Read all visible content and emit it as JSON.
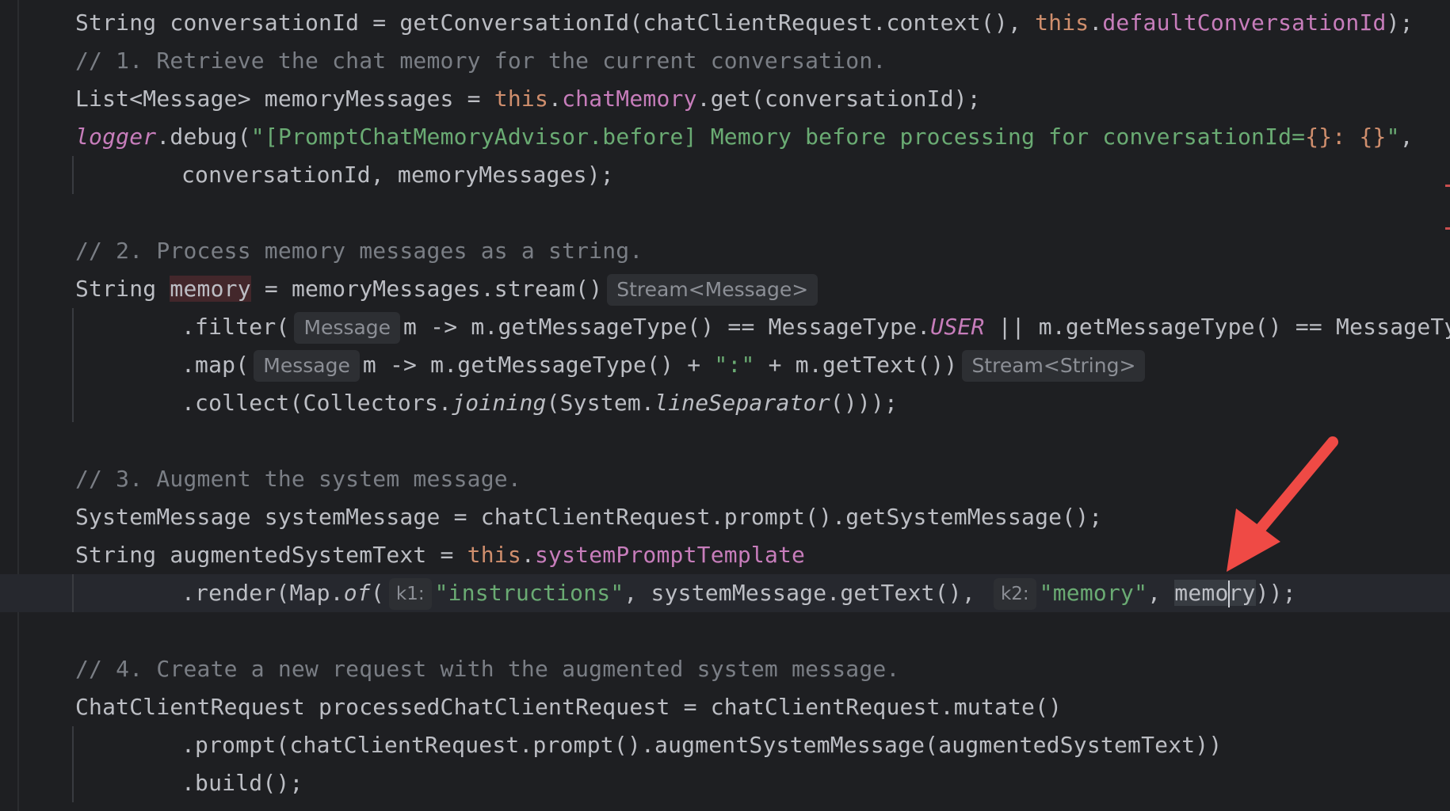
{
  "code": {
    "line1": {
      "a": "String conversationId = getConversationId(chatClientRequest.context(), ",
      "this": "this",
      "dot": ".",
      "field": "defaultConversationId",
      "end": ");"
    },
    "line2": "// 1. Retrieve the chat memory for the current conversation.",
    "line3": {
      "a": "List<Message> memoryMessages = ",
      "this": "this",
      "dot": ".",
      "field": "chatMemory",
      "end": ".get(conversationId);"
    },
    "line4": {
      "logger": "logger",
      "a": ".debug(",
      "str": "\"[PromptChatMemoryAdvisor.before] Memory before processing for conversationId=",
      "braces": "{}: {}",
      "str_end": "\"",
      "end": ","
    },
    "line5": "conversationId, memoryMessages);",
    "line6": "// 2. Process memory messages as a string.",
    "line7": {
      "a": "String ",
      "var": "memory",
      "b": " = memoryMessages.stream()",
      "hint": "Stream<Message>"
    },
    "line8": {
      "a": ".filter(",
      "hint": "Message",
      "b": "m -> m.getMessageType() == MessageType.",
      "enum": "USER",
      "c": " || m.getMessageType() == MessageTyp"
    },
    "line9": {
      "a": ".map(",
      "hint": "Message",
      "b": "m -> m.getMessageType() + ",
      "str": "\":\"",
      "c": " + m.getText())",
      "hint2": "Stream<String>"
    },
    "line10": {
      "a": ".collect(Collectors.",
      "m1": "joining",
      "b": "(System.",
      "m2": "lineSeparator",
      "c": "()));"
    },
    "line11": "// 3. Augment the system message.",
    "line12": "SystemMessage systemMessage = chatClientRequest.prompt().getSystemMessage();",
    "line13": {
      "a": "String augmentedSystemText = ",
      "this": "this",
      "dot": ".",
      "field": "systemPromptTemplate"
    },
    "line14": {
      "a": ".render(Map.",
      "of": "of",
      "b": "(",
      "hint1": "k1:",
      "str1": "\"instructions\"",
      "c": ", systemMessage.getText(), ",
      "hint2": "k2:",
      "str2": "\"memory\"",
      "d": ", ",
      "var_a": "memo",
      "var_b": "ry",
      "end": "));"
    },
    "line15": "// 4. Create a new request with the augmented system message.",
    "line16": "ChatClientRequest processedChatClientRequest = chatClientRequest.mutate()",
    "line17": ".prompt(chatClientRequest.prompt().augmentSystemMessage(augmentedSystemText))",
    "line18": ".build();"
  },
  "colors": {
    "background": "#1e1f22",
    "keyword": "#cf8e6d",
    "field": "#c77dbb",
    "string": "#6aab73",
    "comment": "#7a7e85",
    "annotation_arrow": "#ef4a45"
  }
}
